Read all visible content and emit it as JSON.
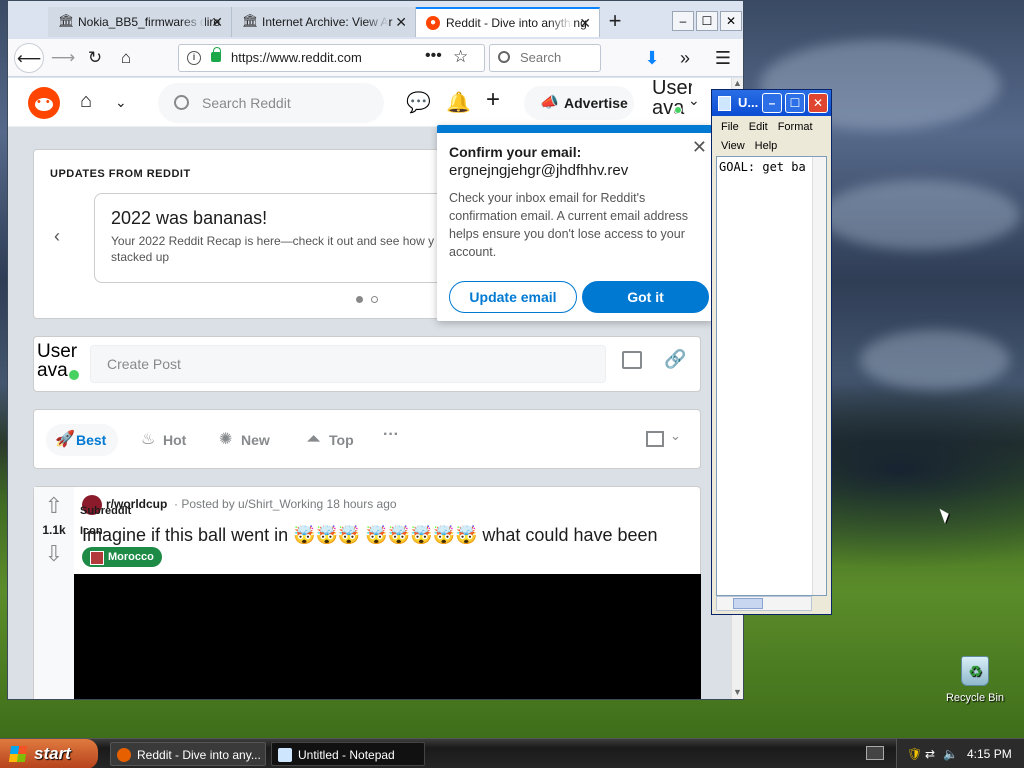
{
  "browser": {
    "tabs": [
      {
        "title": "Nokia_BB5_firmwares dire",
        "icon": "archive-icon"
      },
      {
        "title": "Internet Archive: View Ar",
        "icon": "archive-icon"
      },
      {
        "title": "Reddit - Dive into anything",
        "icon": "reddit-icon",
        "active": true
      }
    ],
    "url": "https://www.reddit.com",
    "search_placeholder": "Search",
    "window_controls": [
      "–",
      "☐",
      "✕"
    ]
  },
  "reddit": {
    "search_placeholder": "Search Reddit",
    "advertise_label": "Advertise",
    "user_avatar_alt": "User ava",
    "updates": {
      "heading": "UPDATES FROM REDDIT",
      "card_title": "2022 was bananas!",
      "card_text": "Your 2022 Reddit Recap is here—check it out and see how y stacked up"
    },
    "create_post": {
      "avatar_alt": "User ava",
      "placeholder": "Create Post"
    },
    "sort_tabs": [
      {
        "label": "Best",
        "active": true
      },
      {
        "label": "Hot"
      },
      {
        "label": "New"
      },
      {
        "label": "Top"
      }
    ],
    "post": {
      "vote_count": "1.1k",
      "subreddit": "r/worldcup",
      "subreddit_icon_alt": "Subreddit Icon",
      "posted_by": "· Posted by u/Shirt_Working 18 hours ago",
      "title": "Imagine if this ball went in 🤯🤯🤯 🤯🤯🤯🤯🤯 what could have been",
      "flair": "Morocco"
    },
    "email_popup": {
      "title": "Confirm your email:",
      "email": "ergnejngjehgr@jhdfhhv.rev",
      "body": "Check your inbox email for Reddit's confirmation email. A current email address helps ensure you don't lose access to your account.",
      "update_button": "Update email",
      "got_it_button": "Got it"
    }
  },
  "notepad": {
    "title": "U...",
    "menu": [
      "File",
      "Edit",
      "Format",
      "View",
      "Help"
    ],
    "content": "GOAL: get ba"
  },
  "desktop": {
    "recycle_bin_label": "Recycle Bin"
  },
  "taskbar": {
    "start_label": "start",
    "buttons": [
      {
        "label": "Reddit - Dive into any...",
        "icon": "firefox-icon"
      },
      {
        "label": "Untitled - Notepad",
        "icon": "notepad-icon"
      }
    ],
    "clock": "4:15 PM"
  },
  "colors": {
    "reddit_orange": "#ff4500",
    "reddit_blue": "#0079d3",
    "xp_blue": "#0a4cd2",
    "start_green": "#3a9b2a"
  }
}
